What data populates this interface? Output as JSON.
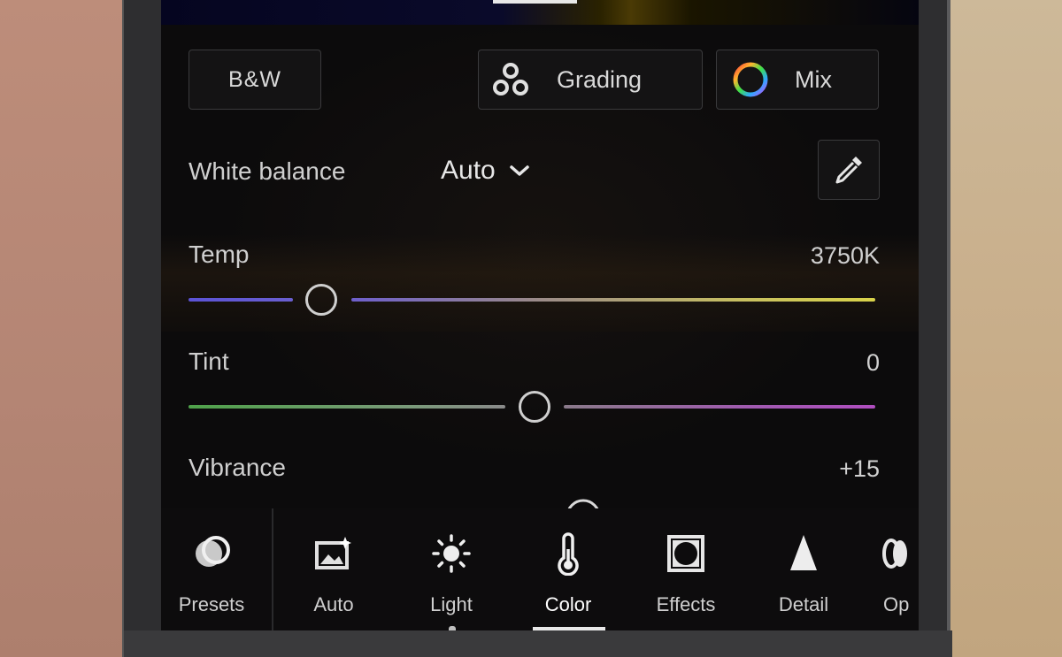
{
  "presets_chips": {
    "bw_label": "B&W",
    "grading_label": "Grading",
    "mix_label": "Mix"
  },
  "white_balance": {
    "label": "White balance",
    "value": "Auto"
  },
  "sliders": {
    "temp": {
      "label": "Temp",
      "value": "3750K",
      "position": 0.19
    },
    "tint": {
      "label": "Tint",
      "value": "0",
      "position": 0.5
    },
    "vibrance": {
      "label": "Vibrance",
      "value": "+15"
    }
  },
  "toolbar": {
    "items": [
      {
        "label": "Presets",
        "icon": "presets-icon"
      },
      {
        "label": "Auto",
        "icon": "auto-icon"
      },
      {
        "label": "Light",
        "icon": "sun-icon"
      },
      {
        "label": "Color",
        "icon": "thermometer-icon",
        "active": true
      },
      {
        "label": "Effects",
        "icon": "effects-icon"
      },
      {
        "label": "Detail",
        "icon": "detail-icon"
      },
      {
        "label": "Op",
        "icon": "optics-icon"
      }
    ]
  },
  "colors": {
    "temp_left": "#5b53d6",
    "temp_right": "#d8d24a",
    "tint_left": "#4fa24a",
    "tint_right": "#b04ec0"
  }
}
